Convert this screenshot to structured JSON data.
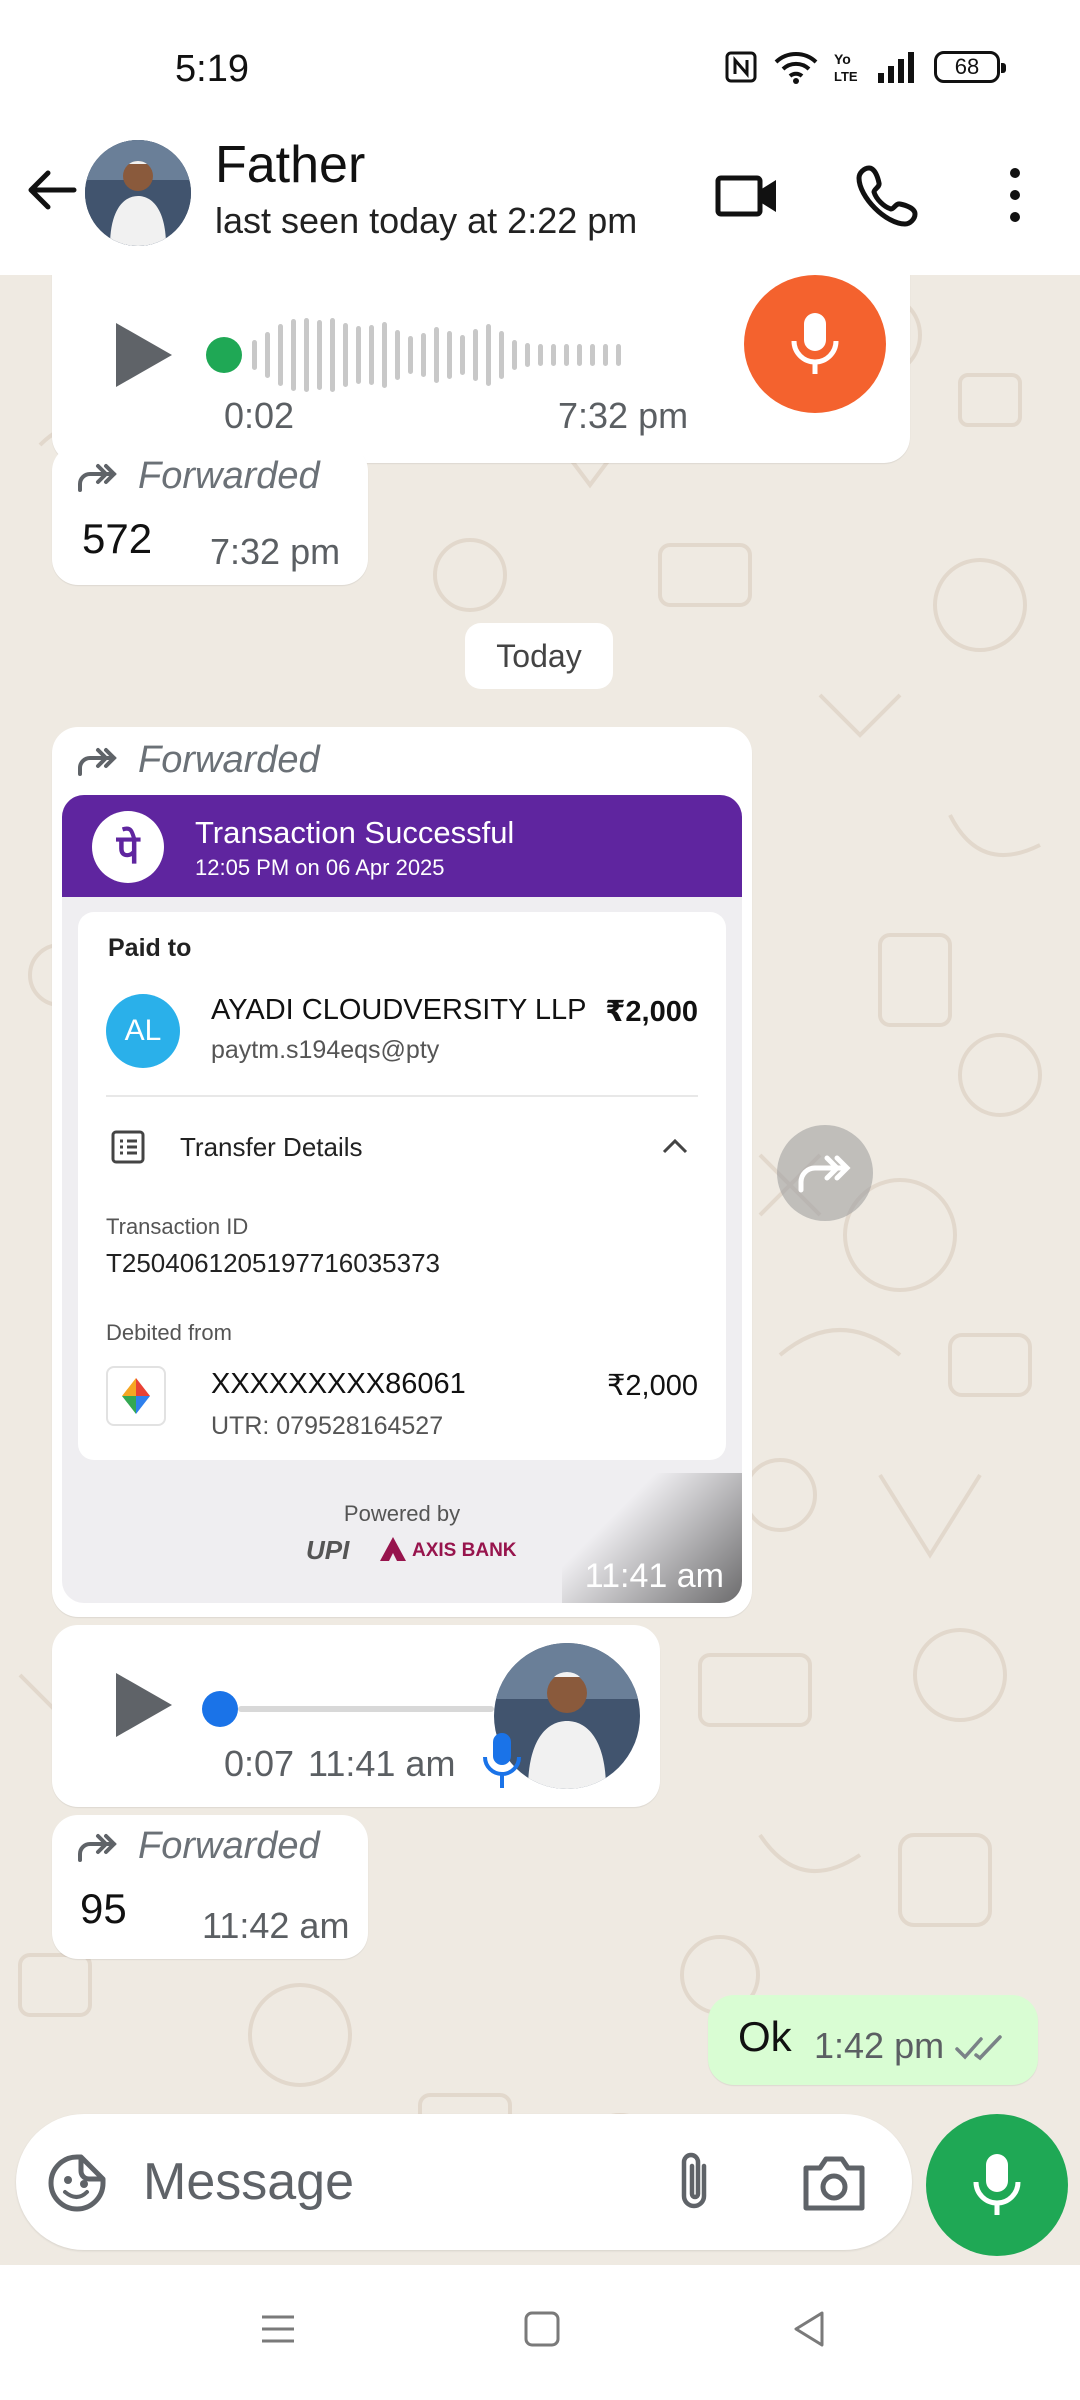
{
  "status_bar": {
    "time": "5:19",
    "battery": "68",
    "icons": [
      "nfc-icon",
      "wifi-icon",
      "volte-icon",
      "signal-icon",
      "battery-icon"
    ]
  },
  "header": {
    "contact_name": "Father",
    "last_seen": "last seen today at 2:22 pm",
    "icons": [
      "back-arrow-icon",
      "video-call-icon",
      "voice-call-icon",
      "more-options-icon"
    ]
  },
  "messages": {
    "voice_note_1": {
      "duration": "0:02",
      "time": "7:32 pm"
    },
    "forward_1": {
      "forwarded_label": "Forwarded",
      "text": "572",
      "time": "7:32 pm"
    },
    "date_divider": "Today",
    "payment_message": {
      "forwarded_label": "Forwarded",
      "time": "11:41 am",
      "card": {
        "brand_glyph": "पे",
        "status_title": "Transaction Successful",
        "status_datetime": "12:05 PM on 06 Apr 2025",
        "paid_to_label": "Paid to",
        "payee_initials": "AL",
        "payee_name": "AYADI CLOUDVERSITY LLP",
        "payee_amount": "₹2,000",
        "payee_upi": "paytm.s194eqs@pty",
        "transfer_details_label": "Transfer Details",
        "transaction_id_label": "Transaction ID",
        "transaction_id": "T2504061205197716035373",
        "debited_from_label": "Debited from",
        "debited_account": "XXXXXXXXX86061",
        "debited_amount": "₹2,000",
        "utr": "UTR: 079528164527",
        "powered_by": "Powered by",
        "upi_logo_text": "UPI",
        "bank_logo_text": "AXIS BANK"
      }
    },
    "voice_note_2": {
      "duration": "0:07",
      "time": "11:41 am"
    },
    "forward_2": {
      "forwarded_label": "Forwarded",
      "text": "95",
      "time": "11:42 am"
    },
    "outgoing": {
      "text": "Ok",
      "time": "1:42 pm",
      "status": "read"
    }
  },
  "composer": {
    "placeholder": "Message",
    "icons": [
      "sticker-icon",
      "attach-icon",
      "camera-icon",
      "mic-icon"
    ]
  },
  "colors": {
    "brand_green": "#1fa855",
    "outgoing_bubble": "#d9fdd3",
    "chat_bg": "#efeae2",
    "phonepe_purple": "#5f259f",
    "record_orange": "#f4622e",
    "voice_dot_green": "#1fa855",
    "voice_dot_blue": "#1a73e8"
  }
}
